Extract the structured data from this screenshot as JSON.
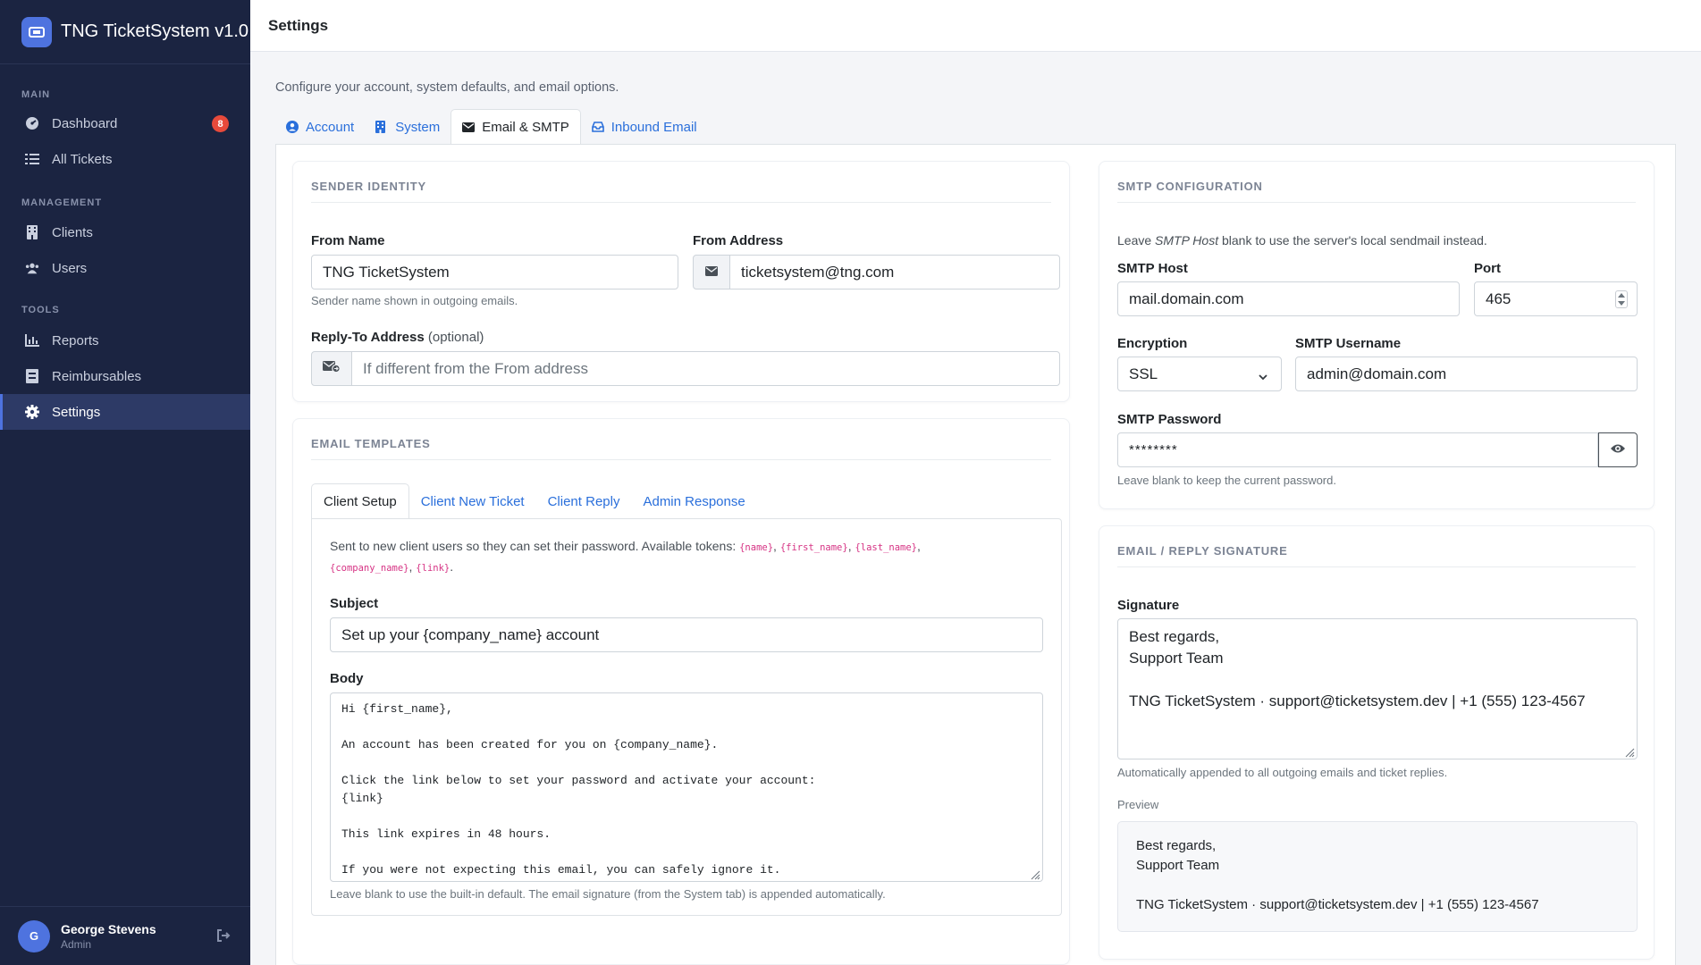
{
  "app": {
    "title": "TNG TicketSystem v1.0"
  },
  "sidebar": {
    "sections": [
      {
        "label": "MAIN"
      },
      {
        "label": "MANAGEMENT"
      },
      {
        "label": "TOOLS"
      }
    ],
    "items": [
      {
        "label": "Dashboard",
        "icon": "dashboard-icon",
        "badge": "8"
      },
      {
        "label": "All Tickets",
        "icon": "list-icon"
      },
      {
        "label": "Clients",
        "icon": "building-icon"
      },
      {
        "label": "Users",
        "icon": "users-icon"
      },
      {
        "label": "Reports",
        "icon": "chart-icon"
      },
      {
        "label": "Reimbursables",
        "icon": "receipt-icon"
      },
      {
        "label": "Settings",
        "icon": "gear-icon",
        "active": true
      }
    ],
    "user": {
      "initial": "G",
      "name": "George Stevens",
      "role": "Admin"
    }
  },
  "header": {
    "title": "Settings"
  },
  "page": {
    "subtitle": "Configure your account, system defaults, and email options.",
    "tabs": [
      {
        "label": "Account",
        "icon": "user-circle-icon"
      },
      {
        "label": "System",
        "icon": "building-icon"
      },
      {
        "label": "Email & SMTP",
        "icon": "envelope-icon",
        "active": true
      },
      {
        "label": "Inbound Email",
        "icon": "inbox-icon"
      }
    ]
  },
  "sender": {
    "heading": "SENDER IDENTITY",
    "from_name_label": "From Name",
    "from_name_value": "TNG TicketSystem",
    "from_name_help": "Sender name shown in outgoing emails.",
    "from_address_label": "From Address",
    "from_address_value": "ticketsystem@tng.com",
    "reply_to_label": "Reply-To Address",
    "reply_to_optional": "(optional)",
    "reply_to_placeholder": "If different from the From address"
  },
  "templates": {
    "heading": "EMAIL TEMPLATES",
    "tabs": [
      {
        "label": "Client Setup",
        "active": true
      },
      {
        "label": "Client New Ticket"
      },
      {
        "label": "Client Reply"
      },
      {
        "label": "Admin Response"
      }
    ],
    "description": "Sent to new client users so they can set their password. Available tokens:",
    "tokens": [
      "{name}",
      "{first_name}",
      "{last_name}",
      "{company_name}",
      "{link}"
    ],
    "subject_label": "Subject",
    "subject_value": "Set up your {company_name} account",
    "body_label": "Body",
    "body_lines": [
      "Hi {first_name},",
      "",
      "An account has been created for you on {company_name}.",
      "",
      "Click the link below to set your password and activate your account:",
      "{link}",
      "",
      "This link expires in 48 hours.",
      "",
      "If you were not expecting this email, you can safely ignore it."
    ],
    "body_help": "Leave blank to use the built-in default. The email signature (from the System tab) is appended automatically."
  },
  "smtp": {
    "heading": "SMTP CONFIGURATION",
    "note_before": "Leave ",
    "note_em": "SMTP Host",
    "note_after": " blank to use the server's local sendmail instead.",
    "host_label": "SMTP Host",
    "host_value": "mail.domain.com",
    "port_label": "Port",
    "port_value": "465",
    "encryption_label": "Encryption",
    "encryption_value": "SSL",
    "username_label": "SMTP Username",
    "username_value": "admin@domain.com",
    "password_label": "SMTP Password",
    "password_value": "********",
    "password_help": "Leave blank to keep the current password."
  },
  "signature": {
    "heading": "EMAIL / REPLY SIGNATURE",
    "label": "Signature",
    "lines": [
      "Best regards,",
      "Support Team",
      "",
      "TNG TicketSystem · support@ticketsystem.dev | +1 (555) 123-4567"
    ],
    "help": "Automatically appended to all outgoing emails and ticket replies.",
    "preview_label": "Preview",
    "preview_lines": [
      "Best regards,",
      "Support Team",
      "",
      "TNG TicketSystem · support@ticketsystem.dev | +1 (555) 123-4567"
    ]
  },
  "colors": {
    "sidebar_bg": "#1b2441",
    "accent": "#4e73df",
    "link": "#2a6fdb",
    "badge": "#e74a3b",
    "token": "#d63384"
  }
}
